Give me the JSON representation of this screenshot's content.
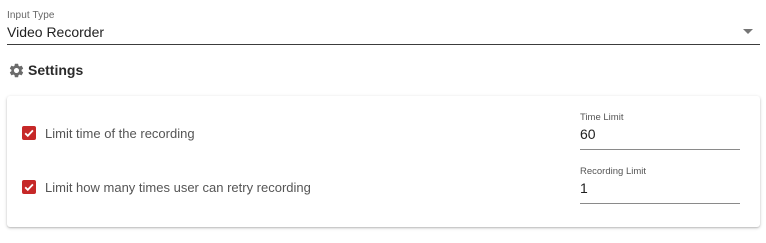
{
  "input_type": {
    "label": "Input Type",
    "value": "Video Recorder"
  },
  "settings": {
    "title": "Settings",
    "icon": "gear-icon",
    "rows": [
      {
        "checkbox_label": "Limit time of the recording",
        "checked": true,
        "field_label": "Time Limit",
        "field_value": "60"
      },
      {
        "checkbox_label": "Limit how many times user can retry recording",
        "checked": true,
        "field_label": "Recording Limit",
        "field_value": "1"
      }
    ]
  },
  "colors": {
    "accent": "#c62828",
    "text": "#212121",
    "muted": "#666666"
  }
}
